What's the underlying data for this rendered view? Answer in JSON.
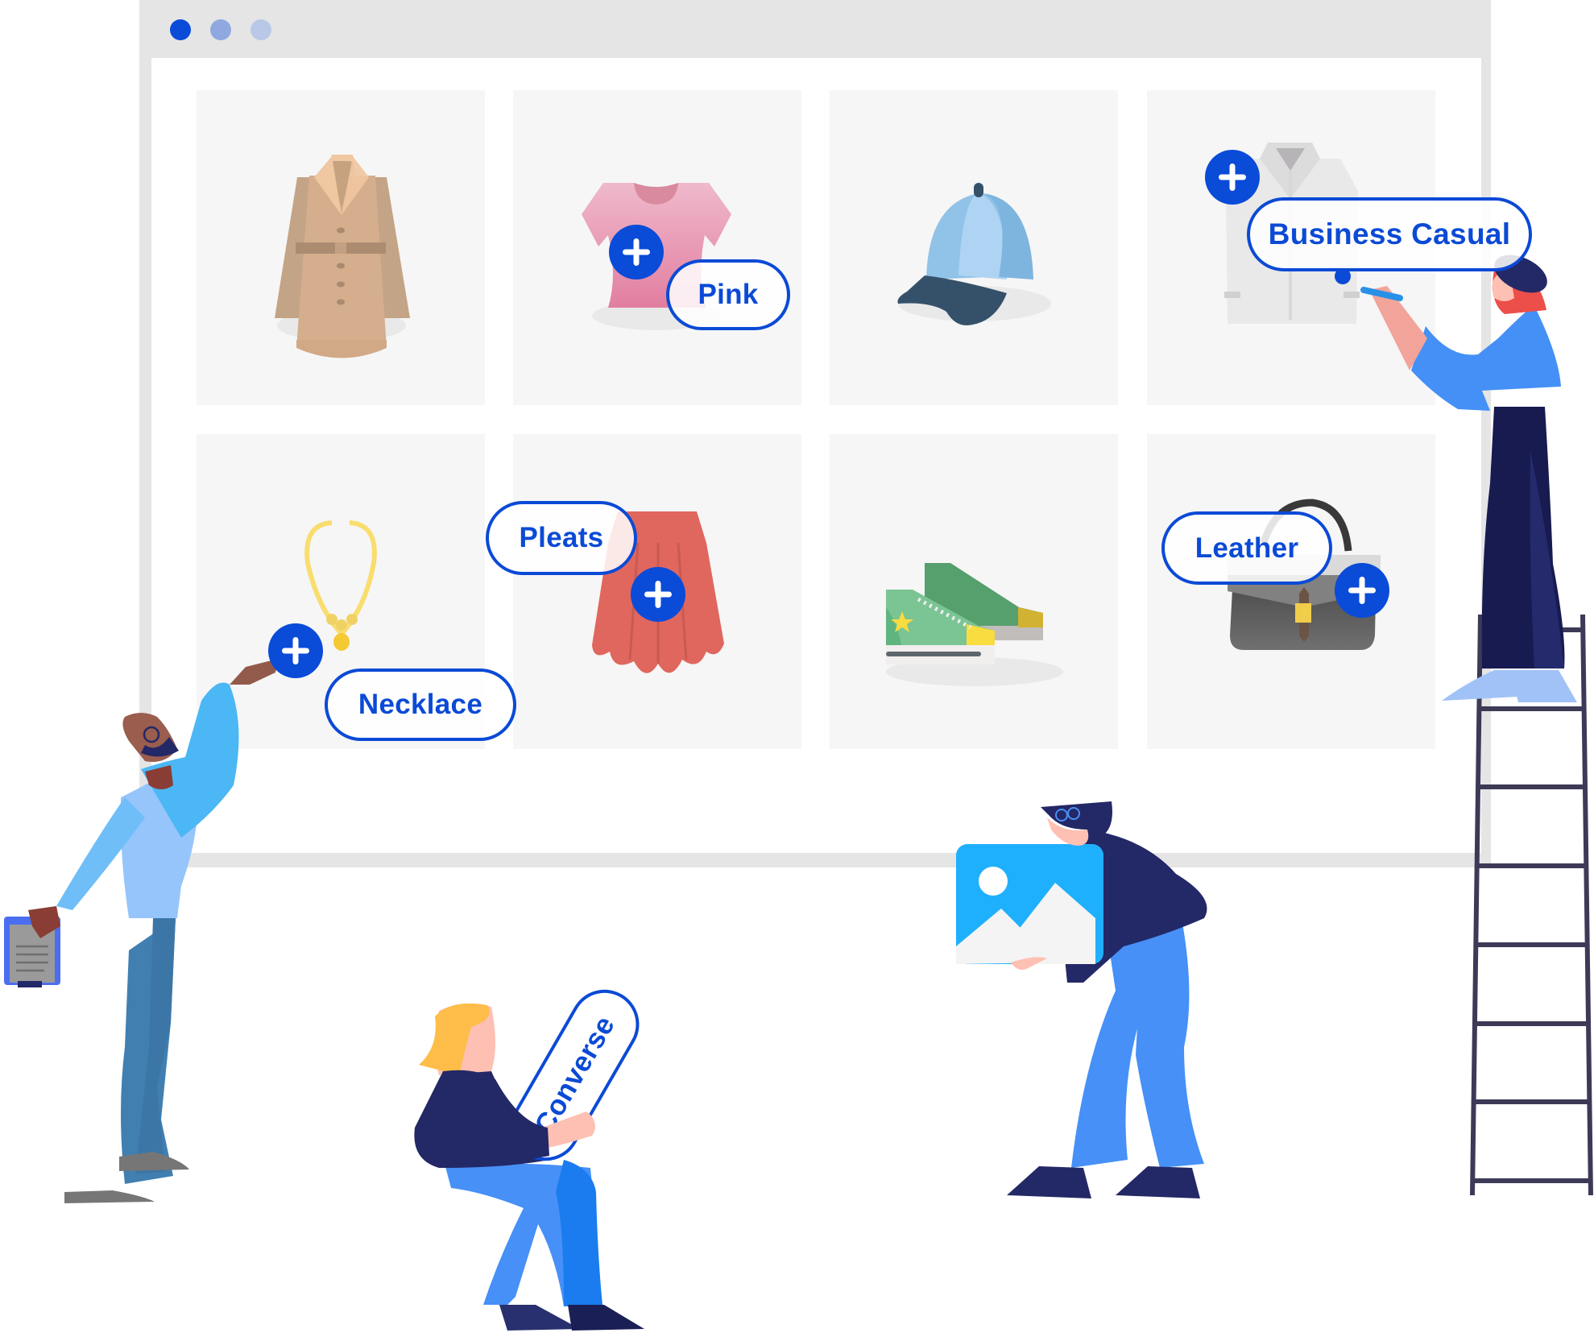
{
  "window": {
    "controls": [
      {
        "name": "close",
        "color": "#0a4bd8"
      },
      {
        "name": "minimize",
        "color": "#8fa8e0"
      },
      {
        "name": "maximize",
        "color": "#b9c8e6"
      }
    ]
  },
  "products": [
    {
      "name": "coat",
      "icon": "coat-icon"
    },
    {
      "name": "t-shirt",
      "icon": "tshirt-icon",
      "tag": "Pink"
    },
    {
      "name": "cap",
      "icon": "cap-icon"
    },
    {
      "name": "shirt",
      "icon": "shirt-icon",
      "tag": "Business Casual"
    },
    {
      "name": "necklace",
      "icon": "necklace-icon",
      "tag": "Necklace"
    },
    {
      "name": "skirt",
      "icon": "skirt-icon",
      "tag": "Pleats"
    },
    {
      "name": "sneakers",
      "icon": "sneakers-icon"
    },
    {
      "name": "handbag",
      "icon": "handbag-icon",
      "tag": "Leather"
    }
  ],
  "tags": {
    "pink": "Pink",
    "business_casual": "Business Casual",
    "necklace": "Necklace",
    "pleats": "Pleats",
    "leather": "Leather",
    "converse": "Converse"
  },
  "colors": {
    "accent": "#0a4bd8",
    "frame": "#e5e5e5",
    "card": "#f6f6f6"
  }
}
